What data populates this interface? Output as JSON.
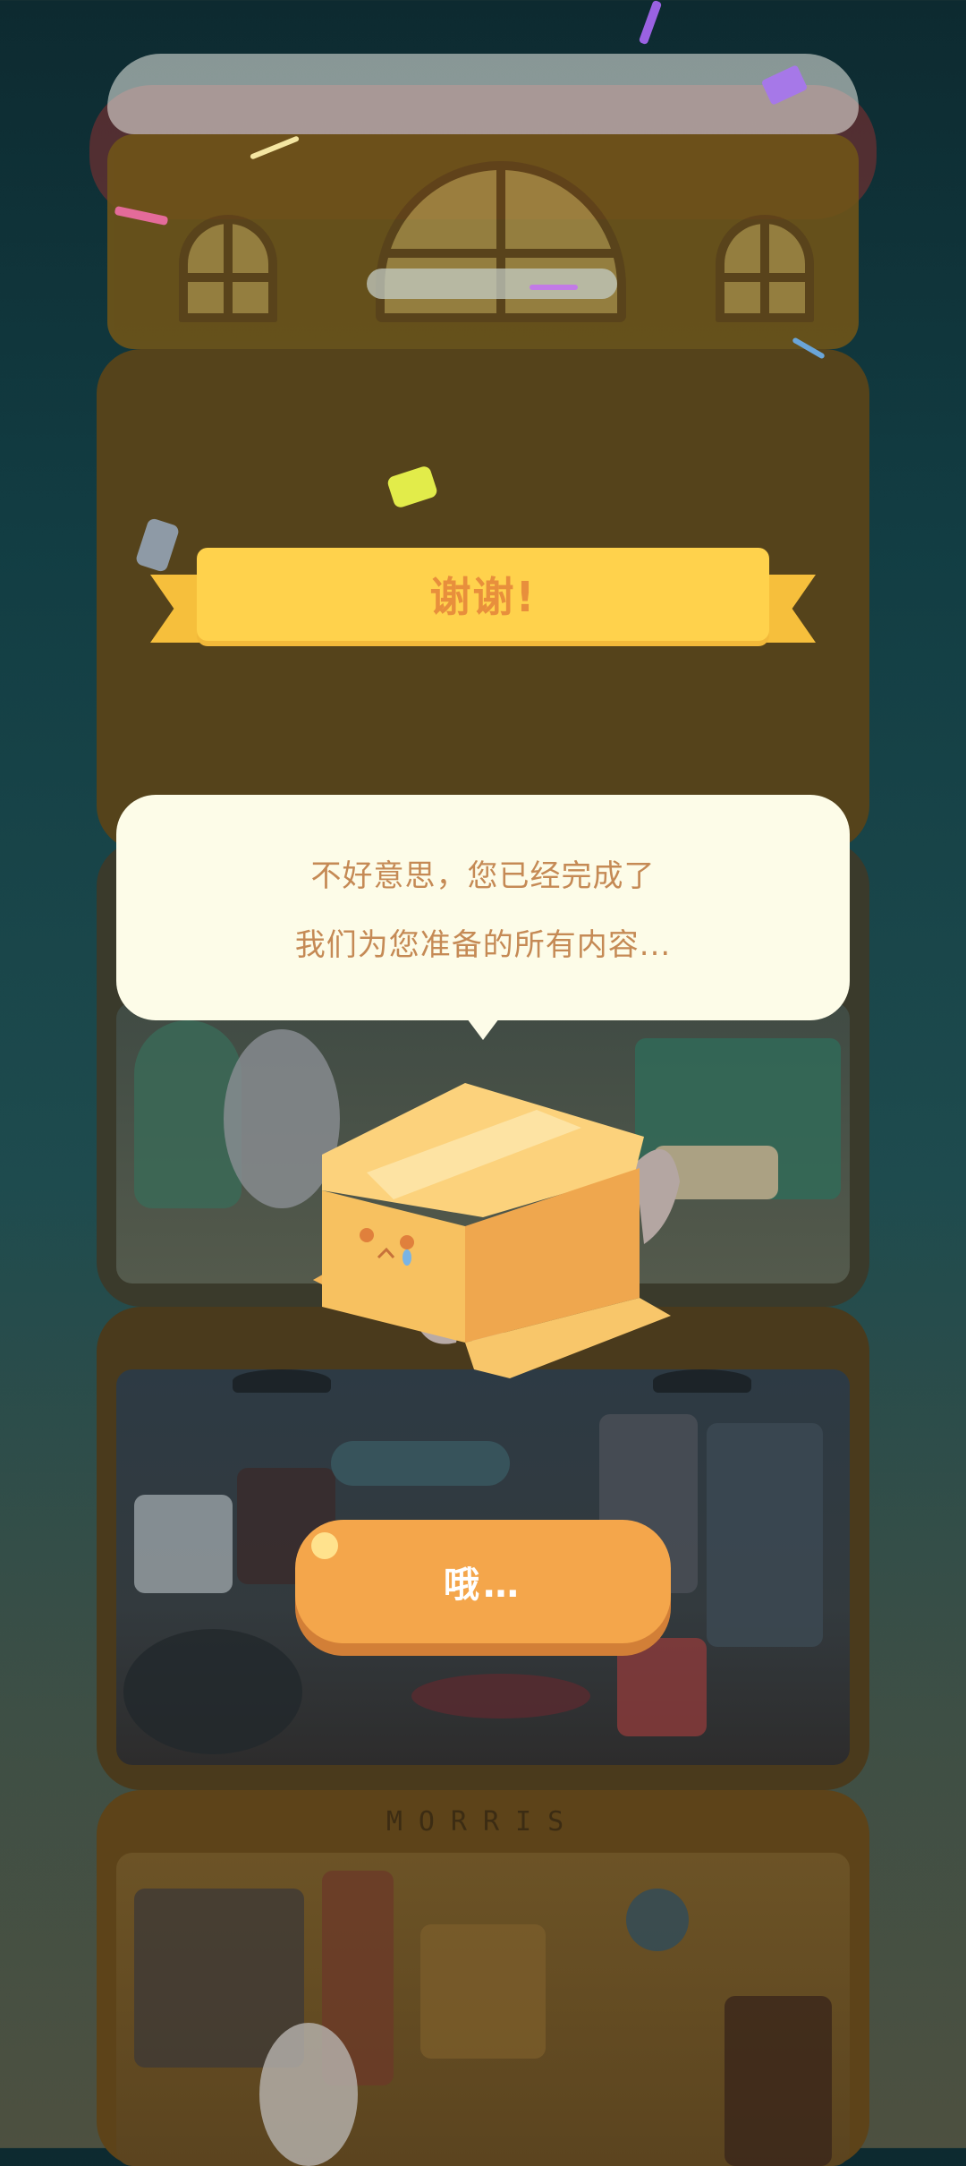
{
  "banner": {
    "title": "谢谢!"
  },
  "dialog": {
    "line1": "不好意思，您已经完成了",
    "line2": "我们为您准备的所有内容..."
  },
  "button": {
    "label": "哦…"
  },
  "background": {
    "floor_sign": "MORRIS"
  },
  "colors": {
    "banner_fill": "#ffd24c",
    "banner_text": "#e88f3c",
    "bubble_fill": "#fdfce8",
    "bubble_text": "#c58a55",
    "button_fill": "#f4a64b",
    "box_fill": "#f6b95a"
  },
  "icons": [
    "cardboard-box-character-icon",
    "gray-cat-icon"
  ]
}
